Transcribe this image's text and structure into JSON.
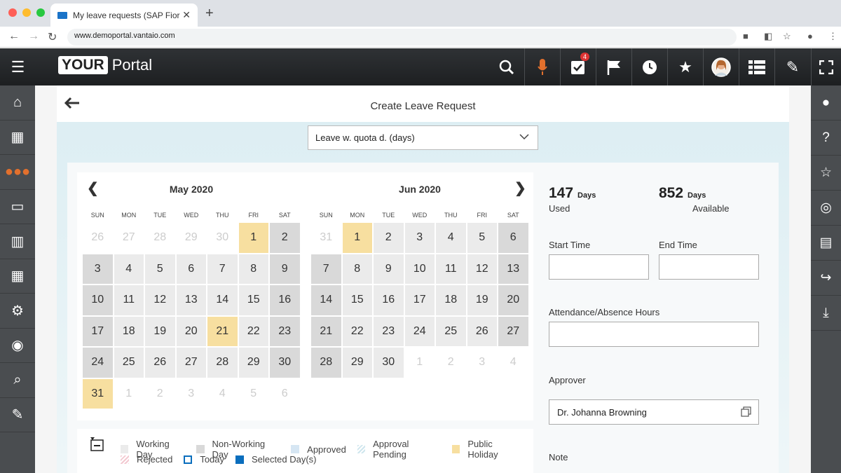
{
  "browser": {
    "tab_title": "My leave requests (SAP Fior",
    "url": "www.demoportal.vantaio.com"
  },
  "portal": {
    "logo_your": "YOUR",
    "logo_portal": "Portal",
    "tasks_badge": "4"
  },
  "page": {
    "title": "Create Leave Request"
  },
  "leave_type": {
    "selected": "Leave w. quota d. (days)"
  },
  "calendar": {
    "left": {
      "title": "May 2020"
    },
    "right": {
      "title": "Jun 2020"
    },
    "dows": [
      "SUN",
      "MON",
      "TUE",
      "WED",
      "THU",
      "FRI",
      "SAT"
    ],
    "may_days": [
      {
        "d": "26",
        "t": "o"
      },
      {
        "d": "27",
        "t": "o"
      },
      {
        "d": "28",
        "t": "o"
      },
      {
        "d": "29",
        "t": "o"
      },
      {
        "d": "30",
        "t": "o"
      },
      {
        "d": "1",
        "t": "h"
      },
      {
        "d": "2",
        "t": "n"
      },
      {
        "d": "3",
        "t": "n"
      },
      {
        "d": "4",
        "t": "w"
      },
      {
        "d": "5",
        "t": "w"
      },
      {
        "d": "6",
        "t": "w"
      },
      {
        "d": "7",
        "t": "w"
      },
      {
        "d": "8",
        "t": "w"
      },
      {
        "d": "9",
        "t": "n"
      },
      {
        "d": "10",
        "t": "n"
      },
      {
        "d": "11",
        "t": "w"
      },
      {
        "d": "12",
        "t": "w"
      },
      {
        "d": "13",
        "t": "w"
      },
      {
        "d": "14",
        "t": "w"
      },
      {
        "d": "15",
        "t": "w"
      },
      {
        "d": "16",
        "t": "n"
      },
      {
        "d": "17",
        "t": "n"
      },
      {
        "d": "18",
        "t": "w"
      },
      {
        "d": "19",
        "t": "w"
      },
      {
        "d": "20",
        "t": "w"
      },
      {
        "d": "21",
        "t": "h"
      },
      {
        "d": "22",
        "t": "w"
      },
      {
        "d": "23",
        "t": "n"
      },
      {
        "d": "24",
        "t": "n"
      },
      {
        "d": "25",
        "t": "w"
      },
      {
        "d": "26",
        "t": "w"
      },
      {
        "d": "27",
        "t": "w"
      },
      {
        "d": "28",
        "t": "w"
      },
      {
        "d": "29",
        "t": "w"
      },
      {
        "d": "30",
        "t": "n"
      },
      {
        "d": "31",
        "t": "h"
      },
      {
        "d": "1",
        "t": "o"
      },
      {
        "d": "2",
        "t": "o"
      },
      {
        "d": "3",
        "t": "o"
      },
      {
        "d": "4",
        "t": "o"
      },
      {
        "d": "5",
        "t": "o"
      },
      {
        "d": "6",
        "t": "o"
      }
    ],
    "jun_days": [
      {
        "d": "31",
        "t": "o"
      },
      {
        "d": "1",
        "t": "h"
      },
      {
        "d": "2",
        "t": "w"
      },
      {
        "d": "3",
        "t": "w"
      },
      {
        "d": "4",
        "t": "w"
      },
      {
        "d": "5",
        "t": "w"
      },
      {
        "d": "6",
        "t": "n"
      },
      {
        "d": "7",
        "t": "n"
      },
      {
        "d": "8",
        "t": "w"
      },
      {
        "d": "9",
        "t": "w"
      },
      {
        "d": "10",
        "t": "w"
      },
      {
        "d": "11",
        "t": "w"
      },
      {
        "d": "12",
        "t": "w"
      },
      {
        "d": "13",
        "t": "n"
      },
      {
        "d": "14",
        "t": "n"
      },
      {
        "d": "15",
        "t": "w"
      },
      {
        "d": "16",
        "t": "w"
      },
      {
        "d": "17",
        "t": "w"
      },
      {
        "d": "18",
        "t": "w"
      },
      {
        "d": "19",
        "t": "w"
      },
      {
        "d": "20",
        "t": "n"
      },
      {
        "d": "21",
        "t": "n"
      },
      {
        "d": "22",
        "t": "w"
      },
      {
        "d": "23",
        "t": "w"
      },
      {
        "d": "24",
        "t": "w"
      },
      {
        "d": "25",
        "t": "w"
      },
      {
        "d": "26",
        "t": "w"
      },
      {
        "d": "27",
        "t": "n"
      },
      {
        "d": "28",
        "t": "n"
      },
      {
        "d": "29",
        "t": "w"
      },
      {
        "d": "30",
        "t": "w"
      },
      {
        "d": "1",
        "t": "o"
      },
      {
        "d": "2",
        "t": "o"
      },
      {
        "d": "3",
        "t": "o"
      },
      {
        "d": "4",
        "t": "o"
      }
    ]
  },
  "legend": {
    "row1": [
      {
        "label": "Working Day",
        "color": "#ebebeb"
      },
      {
        "label": "Non-Working Day",
        "color": "#d9d9d9"
      },
      {
        "label": "Approved",
        "color": "#d6e6f3"
      },
      {
        "label": "Approval Pending",
        "color": "#cfe6ee"
      },
      {
        "label": "Public Holiday",
        "color": "#f7dfa0"
      }
    ],
    "row2": [
      {
        "label": "Rejected",
        "color": "#f7e0e4"
      },
      {
        "label": "Today",
        "color": "#ffffff"
      },
      {
        "label": "Selected Day(s)",
        "color": "#0a6ebd"
      }
    ]
  },
  "quota": {
    "used_value": "147",
    "used_unit": "Days",
    "used_label": "Used",
    "avail_value": "852",
    "avail_unit": "Days",
    "avail_label": "Available"
  },
  "form": {
    "start_time_label": "Start Time",
    "end_time_label": "End Time",
    "hours_label": "Attendance/Absence Hours",
    "approver_label": "Approver",
    "approver_value": "Dr. Johanna Browning",
    "note_label": "Note"
  }
}
